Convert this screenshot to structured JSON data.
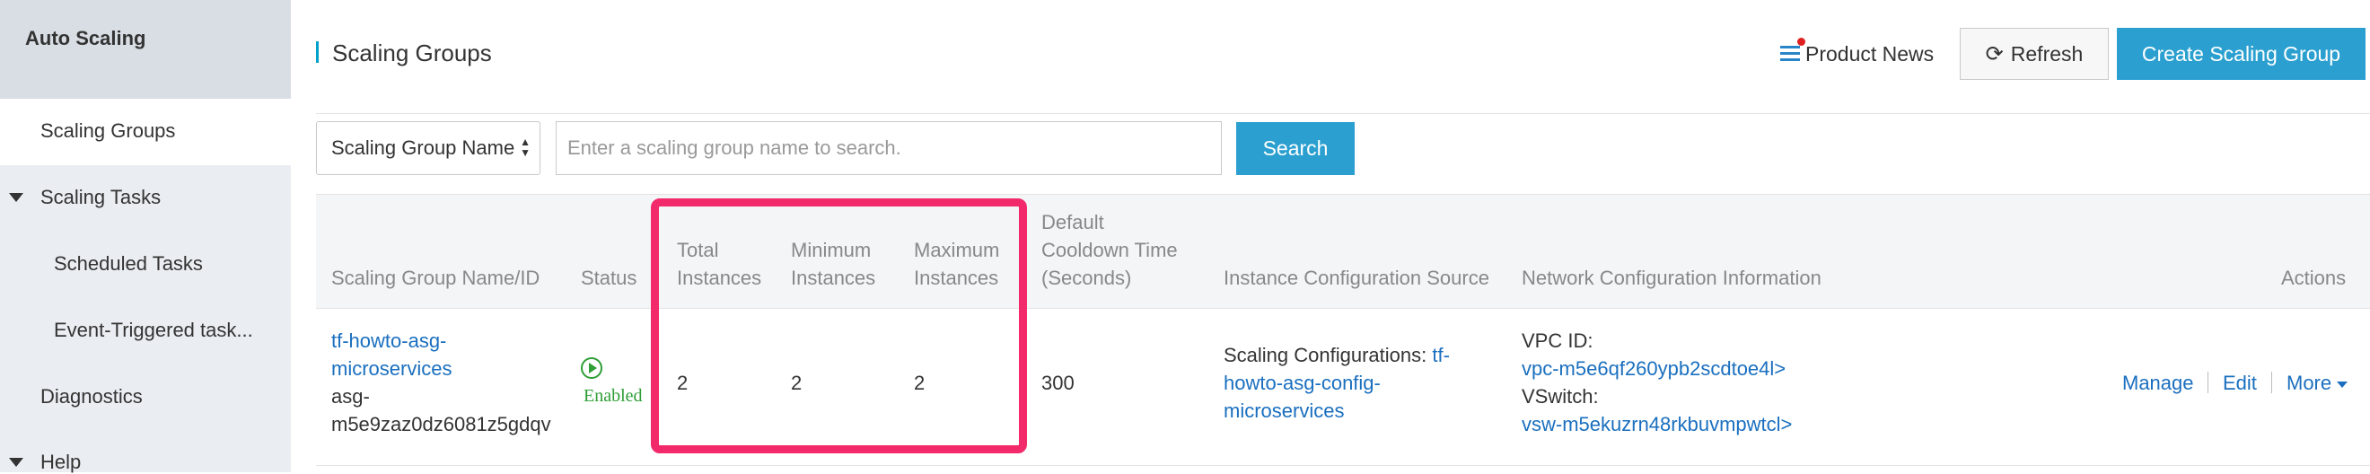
{
  "sidebar": {
    "title": "Auto Scaling",
    "items": [
      {
        "label": "Scaling Groups"
      },
      {
        "label": "Scaling Tasks"
      },
      {
        "label": "Scheduled Tasks"
      },
      {
        "label": "Event-Triggered task..."
      },
      {
        "label": "Diagnostics"
      },
      {
        "label": "Help"
      }
    ]
  },
  "header": {
    "title": "Scaling Groups",
    "product_news": "Product News",
    "refresh": "Refresh",
    "create": "Create Scaling Group"
  },
  "search": {
    "select_value": "Scaling Group Name",
    "placeholder": "Enter a scaling group name to search.",
    "button": "Search"
  },
  "table": {
    "columns": {
      "name": "Scaling Group Name/ID",
      "status": "Status",
      "total": [
        "Total",
        "Instances"
      ],
      "min": [
        "Minimum",
        "Instances"
      ],
      "max": [
        "Maximum",
        "Instances"
      ],
      "cooldown": [
        "Default",
        "Cooldown Time",
        "(Seconds)"
      ],
      "source": "Instance Configuration Source",
      "network": "Network Configuration Information",
      "actions": "Actions"
    },
    "row": {
      "name_lines": [
        "tf-howto-asg-",
        "microservices"
      ],
      "id_lines": [
        "asg-",
        "m5e9zaz0dz6081z5gdqv"
      ],
      "status": "Enabled",
      "total": "2",
      "min": "2",
      "max": "2",
      "cooldown": "300",
      "source_prefix": "Scaling Configurations: ",
      "source_link_1": "tf-",
      "source_link_2": "howto-asg-config-",
      "source_link_3": "microservices",
      "vpc_label": "VPC ID:",
      "vpc_value": "vpc-m5e6qf260ypb2scdtoe4l>",
      "vswitch_label": "VSwitch:",
      "vswitch_value": "vsw-m5ekuzrn48rkbuvmpwtcl>",
      "actions": {
        "manage": "Manage",
        "edit": "Edit",
        "more": "More"
      }
    }
  },
  "colors": {
    "accent": "#2ba0d0",
    "link": "#1a6fbf",
    "highlight": "#f22a6b",
    "enabled": "#2e9e35"
  }
}
